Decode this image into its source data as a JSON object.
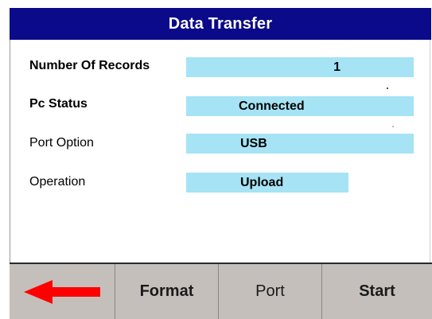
{
  "window": {
    "title": "Data Transfer"
  },
  "fields": {
    "records": {
      "label": "Number Of Records",
      "value": "1"
    },
    "pc_status": {
      "label": "Pc Status",
      "value": "Connected"
    },
    "port_option": {
      "label": "Port Option",
      "value": "USB"
    },
    "operation": {
      "label": "Operation",
      "value": "Upload"
    }
  },
  "buttons": {
    "back_icon": "left-arrow-icon",
    "format_label": "Format",
    "port_label": "Port",
    "start_label": "Start"
  },
  "colors": {
    "title_bar": "#0a0a8a",
    "field_bg": "#a6e3f5",
    "button_bar": "#c3bdb9",
    "arrow": "#ff0000"
  }
}
